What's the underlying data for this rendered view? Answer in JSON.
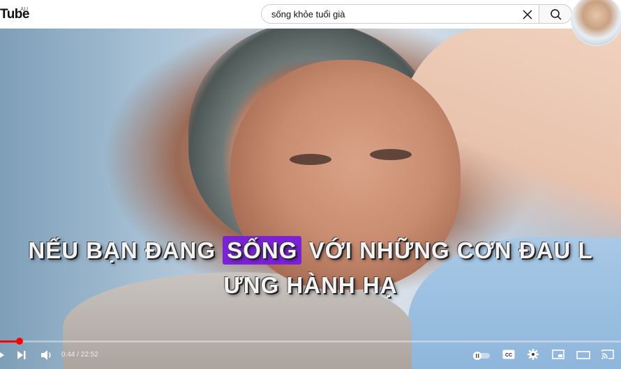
{
  "header": {
    "logo_text": "Tube",
    "region": "AU",
    "search": {
      "value": "sống khỏe tuổi già"
    }
  },
  "video": {
    "subtitle_line1_before": "NẾU BẠN ĐANG ",
    "subtitle_highlight": "SỐNG",
    "subtitle_line1_after": " VỚI NHỮNG CƠN ĐAU L",
    "subtitle_line2": "ƯNG HÀNH HẠ",
    "highlight_color": "#7b22d9"
  },
  "player": {
    "time_display": "0:44 / 22:52",
    "progress": 0.032,
    "progress_color": "#ff0000"
  }
}
